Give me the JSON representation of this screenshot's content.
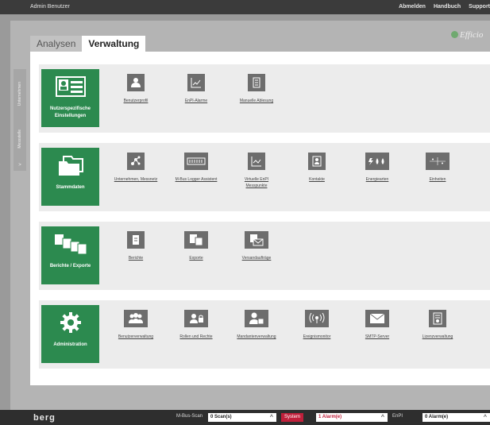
{
  "topbar": {
    "user": "Admin Benutzer",
    "links": [
      "Abmelden",
      "Handbuch",
      "Support"
    ]
  },
  "logo": {
    "text": "Efficio"
  },
  "tabs": [
    {
      "label": "Analysen",
      "active": false
    },
    {
      "label": "Verwaltung",
      "active": true
    }
  ],
  "sidebar": {
    "items": [
      "Unternehmen",
      "Messstelle"
    ],
    "arrow": ">"
  },
  "sections": [
    {
      "tile": {
        "label": "Nutzerspezifische Einstellungen",
        "icon": "user-card-icon"
      },
      "items": [
        {
          "label": "Benutzerprofil",
          "icon": "user-profile-icon"
        },
        {
          "label": "EnPI-Alarme",
          "icon": "chart-alarm-icon"
        },
        {
          "label": "Manuelle Ablesung",
          "icon": "document-list-icon"
        }
      ]
    },
    {
      "tile": {
        "label": "Stammdaten",
        "icon": "folder-icon"
      },
      "items": [
        {
          "label": "Unternehmen, Messnetz",
          "icon": "network-icon"
        },
        {
          "label": "M-Bus Logger Assistent",
          "icon": "logger-icon"
        },
        {
          "label": "Virtuelle EnPI Messpunkte",
          "icon": "chart-line-icon"
        },
        {
          "label": "Kontakte",
          "icon": "contacts-icon"
        },
        {
          "label": "Energiearten",
          "icon": "energy-types-icon"
        },
        {
          "label": "Einheiten",
          "icon": "units-icon"
        }
      ]
    },
    {
      "tile": {
        "label": "Berichte / Exporte",
        "icon": "reports-stack-icon"
      },
      "items": [
        {
          "label": "Berichte",
          "icon": "report-icon"
        },
        {
          "label": "Exporte",
          "icon": "export-icon"
        },
        {
          "label": "Versandaufträge",
          "icon": "mail-document-icon"
        }
      ]
    },
    {
      "tile": {
        "label": "Administration",
        "icon": "gear-icon"
      },
      "items": [
        {
          "label": "Benutzerverwaltung",
          "icon": "users-icon"
        },
        {
          "label": "Rollen und Rechte",
          "icon": "roles-icon"
        },
        {
          "label": "Mandantenverwaltung",
          "icon": "tenants-icon"
        },
        {
          "label": "Ereignismonitor",
          "icon": "event-monitor-icon"
        },
        {
          "label": "SMTP-Server",
          "icon": "envelope-icon"
        },
        {
          "label": "Lizenzverwaltung",
          "icon": "license-icon"
        }
      ]
    }
  ],
  "statusbar": {
    "brand": "berg",
    "mbus_label": "M-Bus-Scan",
    "mbus_value": "0 Scan(s)",
    "system_label": "System",
    "system_value": "1 Alarm(e)",
    "enpi_label": "EnPI",
    "enpi_value": "0 Alarm(e)",
    "chevron": "^"
  },
  "colors": {
    "green": "#2c8a4f",
    "alarm_red": "#c0203b",
    "icon_gray": "#6d6d6d"
  }
}
